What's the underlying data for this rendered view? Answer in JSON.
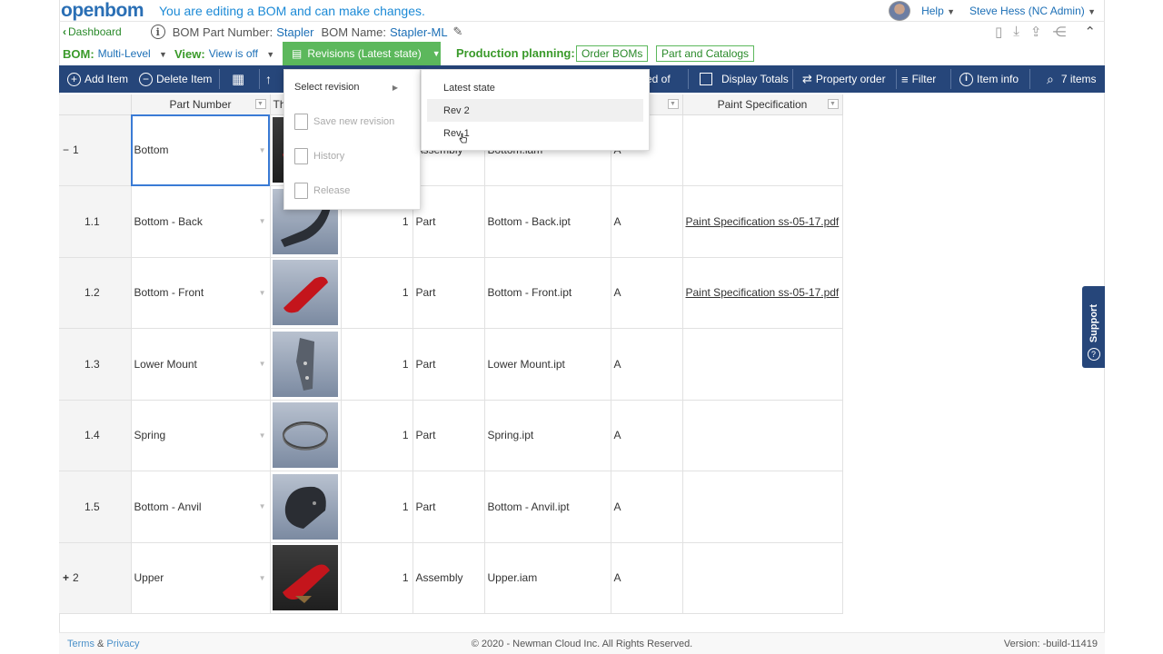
{
  "app": {
    "logo": "openbom",
    "edit_message": "You are editing a BOM and can make changes.",
    "help": "Help",
    "user": "Steve Hess (NC Admin)"
  },
  "breadcrumb": {
    "dashboard": "Dashboard",
    "part_number_label": "BOM Part Number:",
    "part_number_value": "Stapler",
    "bom_name_label": "BOM Name:",
    "bom_name_value": "Stapler-ML"
  },
  "bom_bar": {
    "bom_label": "BOM:",
    "bom_value": "Multi-Level",
    "view_label": "View:",
    "view_value": "View is off",
    "revisions_button": "Revisions (Latest state)",
    "production_label": "Production planning:",
    "order_boms": "Order BOMs",
    "parts_catalogs": "Part and Catalogs"
  },
  "toolbar": {
    "add_item": "Add Item",
    "delete_item": "Delete Item",
    "used_of": "sed of",
    "display_totals": "Display Totals",
    "property_order": "Property order",
    "filter": "Filter",
    "item_info": "Item info",
    "items_count": "7 items"
  },
  "grid": {
    "headers": {
      "part_number": "Part Number",
      "thumb": "Th",
      "paint_spec": "Paint Specification"
    },
    "rows": [
      {
        "num": "1",
        "prefix": "−",
        "part": "Bottom",
        "qty": "",
        "type": "Assembly",
        "file": "Bottom.iam",
        "rev": "A",
        "paint": ""
      },
      {
        "num": "1.1",
        "prefix": "",
        "part": "Bottom - Back",
        "qty": "1",
        "type": "Part",
        "file": "Bottom - Back.ipt",
        "rev": "A",
        "paint": "Paint Specification ss-05-17.pdf"
      },
      {
        "num": "1.2",
        "prefix": "",
        "part": "Bottom - Front",
        "qty": "1",
        "type": "Part",
        "file": "Bottom - Front.ipt",
        "rev": "A",
        "paint": "Paint Specification ss-05-17.pdf"
      },
      {
        "num": "1.3",
        "prefix": "",
        "part": "Lower Mount",
        "qty": "1",
        "type": "Part",
        "file": "Lower Mount.ipt",
        "rev": "A",
        "paint": ""
      },
      {
        "num": "1.4",
        "prefix": "",
        "part": "Spring",
        "qty": "1",
        "type": "Part",
        "file": "Spring.ipt",
        "rev": "A",
        "paint": ""
      },
      {
        "num": "1.5",
        "prefix": "",
        "part": "Bottom - Anvil",
        "qty": "1",
        "type": "Part",
        "file": "Bottom - Anvil.ipt",
        "rev": "A",
        "paint": ""
      },
      {
        "num": "2",
        "prefix": "+",
        "part": "Upper",
        "qty": "1",
        "type": "Assembly",
        "file": "Upper.iam",
        "rev": "A",
        "paint": ""
      }
    ]
  },
  "revision_menu": {
    "select_revision": "Select revision",
    "save_new_revision": "Save new revision",
    "history": "History",
    "release": "Release",
    "sub": [
      "Latest state",
      "Rev 2",
      "Rev 1"
    ]
  },
  "support": "Support",
  "footer": {
    "terms": "Terms",
    "amp": "&",
    "privacy": "Privacy",
    "copyright": "© 2020 - Newman Cloud Inc. All Rights Reserved.",
    "version": "Version: -build-11419"
  }
}
